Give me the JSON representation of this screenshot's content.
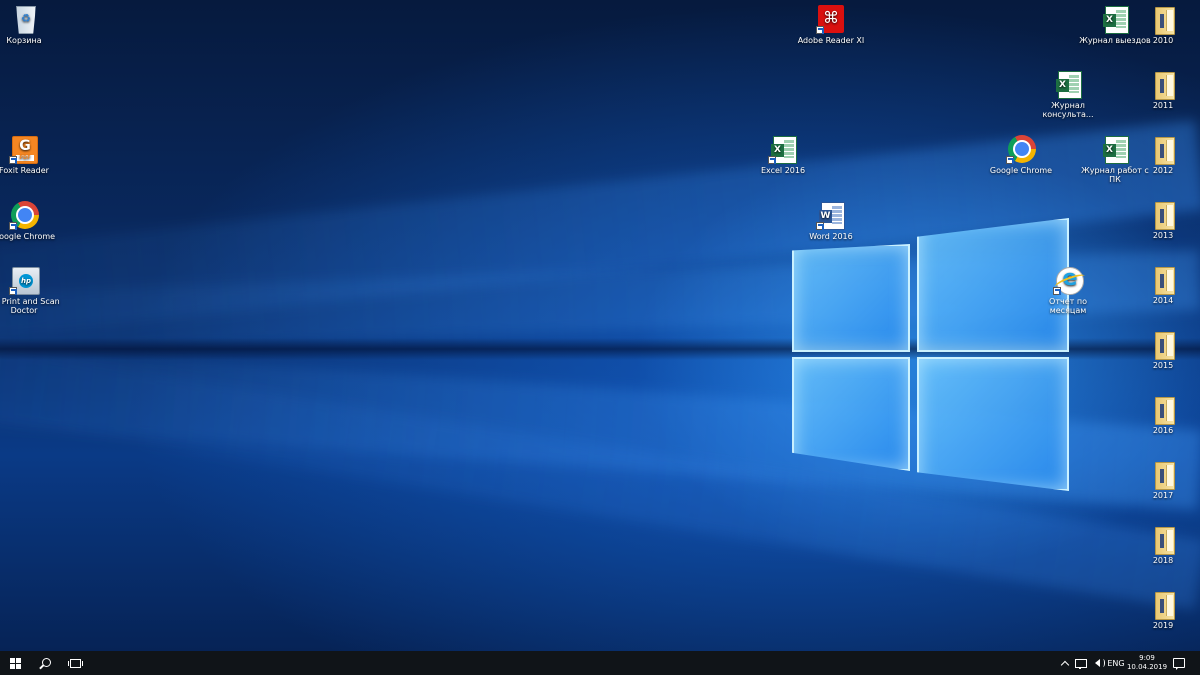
{
  "desktop": {
    "icons": {
      "recycle_bin": "Корзина",
      "foxit_reader": "Foxit Reader",
      "google_chrome_left": "Google Chrome",
      "hp_print_scan": "HP Print and Scan Doctor",
      "adobe_reader": "Adobe Reader XI",
      "excel_2016": "Excel 2016",
      "word_2016": "Word 2016",
      "google_chrome_right": "Google Chrome",
      "report_by_month": "Отчет по месяцам",
      "journal_trips": "Журнал выездов",
      "journal_consult": "Журнал консульта...",
      "journal_pc_work": "Журнал работ с ПК"
    },
    "folders": [
      "2010",
      "2011",
      "2012",
      "2013",
      "2014",
      "2015",
      "2016",
      "2017",
      "2018",
      "2019"
    ]
  },
  "taskbar": {
    "language": "ENG",
    "time": "9:09",
    "date": "10.04.2019"
  },
  "icons": {
    "start": "windows-logo-icon",
    "search": "search-icon",
    "task_view": "task-view-icon",
    "tray_chevron": "chevron-up-icon",
    "network": "network-icon",
    "volume": "volume-icon",
    "notifications": "notification-center-icon"
  },
  "colors": {
    "taskbar_bg": "#101418",
    "wallpaper_accent": "#1e78e0",
    "excel_green": "#1d6f42",
    "word_blue": "#2b579a",
    "adobe_red": "#d9100f",
    "foxit_orange": "#f48622"
  }
}
